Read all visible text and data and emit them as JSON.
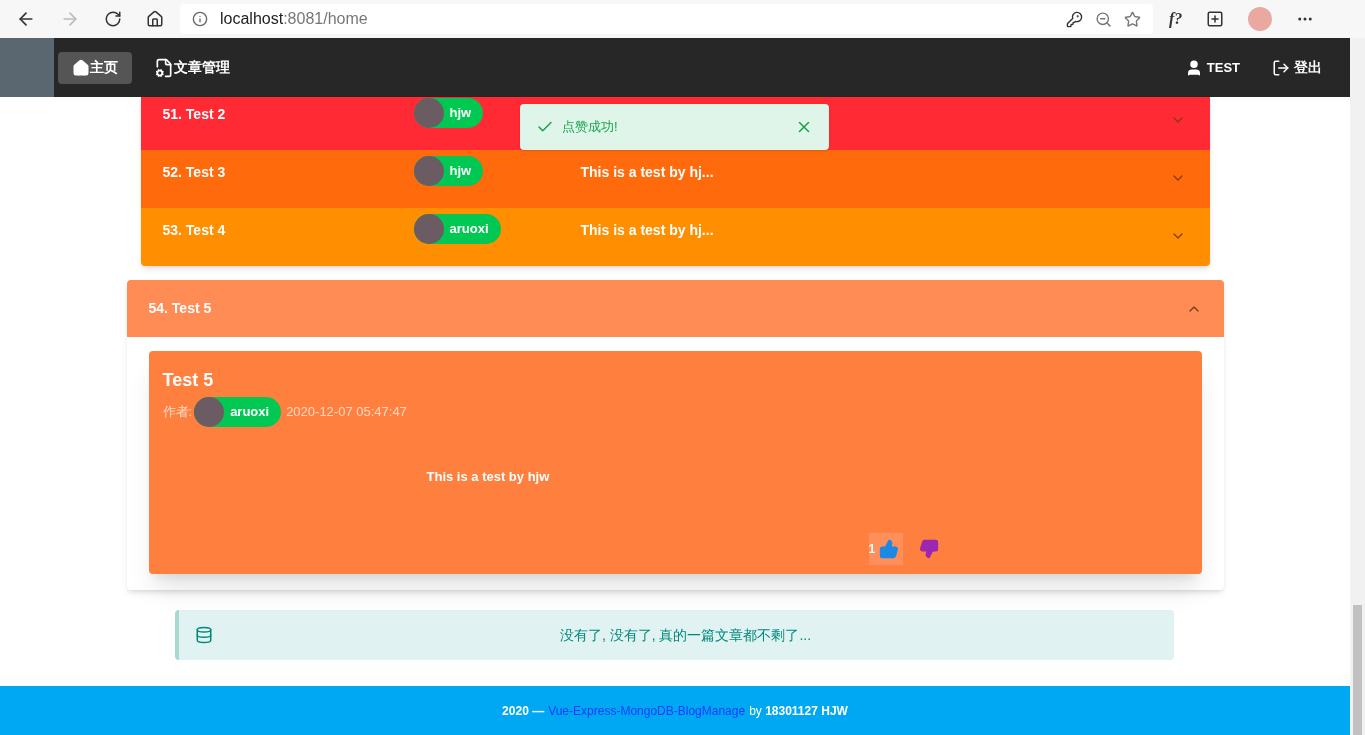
{
  "browser": {
    "url_host": "localhost",
    "url_rest": ":8081/home",
    "font_button": "f?"
  },
  "nav": {
    "items": [
      {
        "label": "主页",
        "selected": true,
        "kind": "home"
      },
      {
        "label": "文章管理",
        "selected": false,
        "kind": "articles"
      }
    ],
    "user": "TEST",
    "logout": "登出"
  },
  "posts": [
    {
      "title": "51. Test 2",
      "author": "hjw",
      "color": "#ff2a33",
      "expanded": false
    },
    {
      "title": "52. Test 3",
      "author": "hjw",
      "summary": "This is a test by hj...",
      "color": "#ff6a0d",
      "expanded": false
    },
    {
      "title": "53. Test 4",
      "author": "aruoxi",
      "summary": "This is a test by hj...",
      "color": "#ff8f00",
      "expanded": false
    },
    {
      "title": "54. Test 5",
      "color": "#ff8c55",
      "expanded": true,
      "detail": {
        "title": "Test 5",
        "author_label": "作者:",
        "author": "aruoxi",
        "date": "2020-12-07 05:47:47",
        "body": "This is a test by hjw",
        "likes": "1",
        "liked": true
      }
    }
  ],
  "toast": {
    "text": "点赞成功!"
  },
  "alert": {
    "text": "没有了, 没有了, 真的一篇文章都不剩了..."
  },
  "footer": {
    "prefix": "2020 —",
    "link": "Vue-Express-MongoDB-BlogManage",
    "suffix": "by **18301127 HJW**"
  }
}
